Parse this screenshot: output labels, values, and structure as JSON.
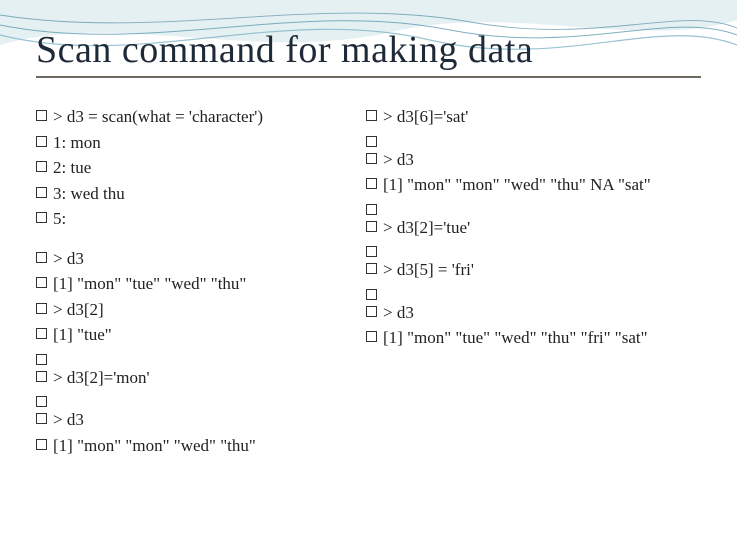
{
  "title": "Scan command for making data",
  "left": [
    "> d3 = scan(what = 'character')",
    "1: mon",
    "2: tue",
    "3: wed thu",
    "5:",
    "",
    "> d3",
    "[1] \"mon\" \"tue\" \"wed\" \"thu\"",
    "> d3[2]",
    "[1] \"tue\"",
    " ",
    "> d3[2]='mon'",
    " ",
    "> d3",
    "[1] \"mon\" \"mon\" \"wed\" \"thu\""
  ],
  "right": [
    "> d3[6]='sat'",
    " ",
    "> d3",
    "[1] \"mon\" \"mon\" \"wed\" \"thu\" NA \"sat\"",
    " ",
    "> d3[2]='tue'",
    " ",
    "> d3[5] = 'fri'",
    " ",
    "> d3",
    "[1] \"mon\" \"tue\" \"wed\" \"thu\" \"fri\" \"sat\""
  ]
}
